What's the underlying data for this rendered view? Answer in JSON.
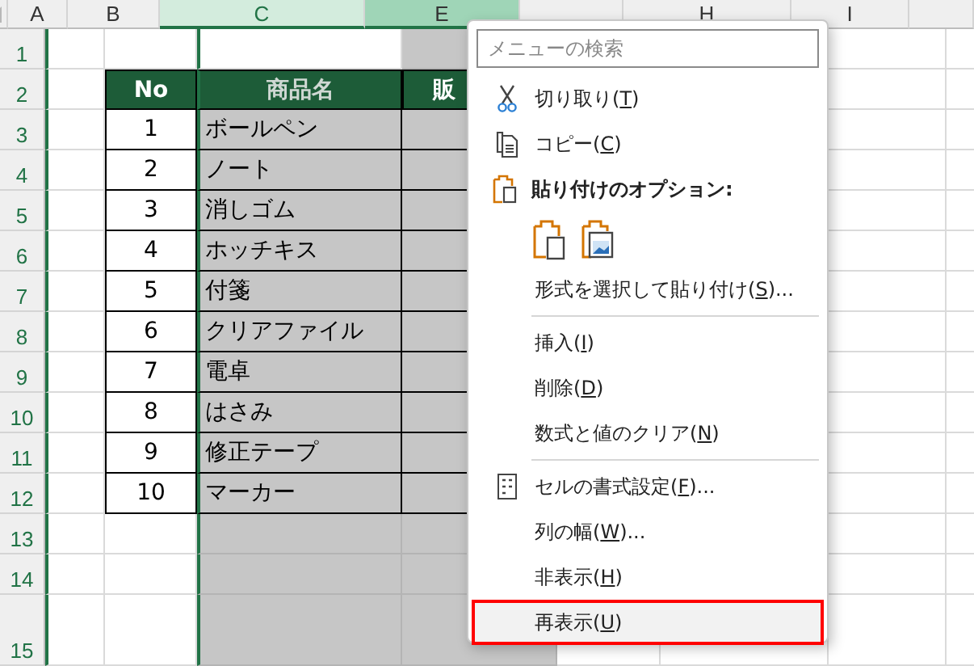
{
  "sheet": {
    "columns": [
      {
        "label": "A",
        "selected": false,
        "active": false
      },
      {
        "label": "B",
        "selected": false,
        "active": false
      },
      {
        "label": "C",
        "selected": true,
        "active": true
      },
      {
        "label": "E",
        "selected": true,
        "active": false
      },
      {
        "selected": false,
        "active": false
      },
      {
        "label": "H",
        "selected": false,
        "active": false
      },
      {
        "label": "I",
        "selected": false,
        "active": false
      },
      {
        "selected": false,
        "active": false
      }
    ],
    "rows": [
      "1",
      "2",
      "3",
      "4",
      "5",
      "6",
      "7",
      "8",
      "9",
      "10",
      "11",
      "12",
      "13",
      "14",
      "15"
    ],
    "table": {
      "header": [
        "No",
        "商品名",
        "販"
      ],
      "rows": [
        [
          "1",
          "ボールペン"
        ],
        [
          "2",
          "ノート"
        ],
        [
          "3",
          "消しゴム"
        ],
        [
          "4",
          "ホッチキス"
        ],
        [
          "5",
          "付箋"
        ],
        [
          "6",
          "クリアファイル"
        ],
        [
          "7",
          "電卓"
        ],
        [
          "8",
          "はさみ"
        ],
        [
          "9",
          "修正テープ"
        ],
        [
          "10",
          "マーカー"
        ]
      ]
    }
  },
  "context_menu": {
    "search_placeholder": "メニューの検索",
    "items": [
      {
        "kind": "icon-item",
        "label": "切り取り(T)",
        "highlighted": false
      },
      {
        "kind": "icon-item",
        "label": "コピー(C)",
        "highlighted": false
      },
      {
        "kind": "heading",
        "label": "貼り付けのオプション:"
      },
      {
        "kind": "paste-buttons"
      },
      {
        "kind": "item",
        "label": "形式を選択して貼り付け(S)...",
        "highlighted": false
      },
      {
        "kind": "separator"
      },
      {
        "kind": "item",
        "label": "挿入(I)",
        "highlighted": false
      },
      {
        "kind": "item",
        "label": "削除(D)",
        "highlighted": false
      },
      {
        "kind": "item",
        "label": "数式と値のクリア(N)",
        "highlighted": false
      },
      {
        "kind": "separator"
      },
      {
        "kind": "icon-item",
        "label": "セルの書式設定(F)...",
        "highlighted": false
      },
      {
        "kind": "item",
        "label": "列の幅(W)...",
        "highlighted": false
      },
      {
        "kind": "item",
        "label": "非表示(H)",
        "highlighted": false
      },
      {
        "kind": "item",
        "label": "再表示(U)",
        "highlighted": true
      }
    ]
  }
}
